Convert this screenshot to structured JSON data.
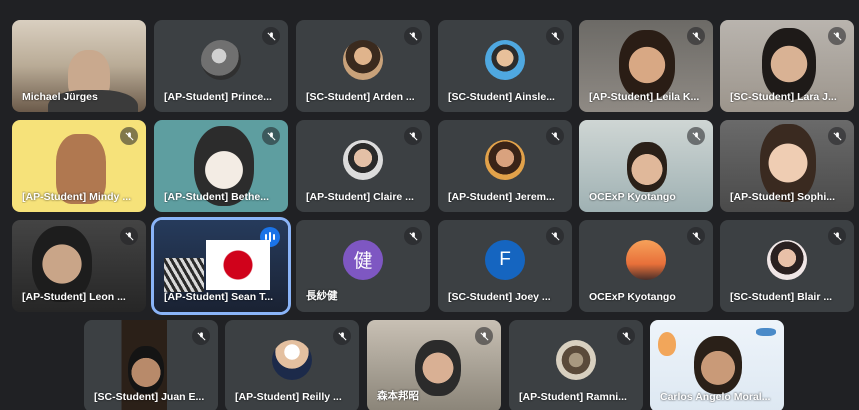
{
  "participants": [
    {
      "name": "Michael Jürges"
    },
    {
      "name": "[AP-Student] Prince..."
    },
    {
      "name": "[SC-Student] Arden ..."
    },
    {
      "name": "[SC-Student] Ainsle..."
    },
    {
      "name": "[AP-Student] Leila K..."
    },
    {
      "name": "[SC-Student] Lara J..."
    },
    {
      "name": "[AP-Student] Mindy ..."
    },
    {
      "name": "[AP-Student] Bethe..."
    },
    {
      "name": "[AP-Student] Claire ..."
    },
    {
      "name": "[AP-Student] Jerem..."
    },
    {
      "name": "OCExP Kyotango"
    },
    {
      "name": "[AP-Student] Sophi..."
    },
    {
      "name": "[AP-Student] Leon ..."
    },
    {
      "name": "[AP-Student] Sean T..."
    },
    {
      "name": "長紗健",
      "avatar_text": "健",
      "avatar_color": "#7e57c2"
    },
    {
      "name": "[SC-Student] Joey ...",
      "avatar_text": "F",
      "avatar_color": "#1565c0"
    },
    {
      "name": "OCExP Kyotango"
    },
    {
      "name": "[SC-Student] Blair ..."
    },
    {
      "name": "[SC-Student] Juan E..."
    },
    {
      "name": "[AP-Student] Reilly ..."
    },
    {
      "name": "森本邦昭"
    },
    {
      "name": "[AP-Student] Ramni..."
    },
    {
      "name": "Carlos Angelo Moral..."
    }
  ],
  "icons": {
    "muted": "mic-off-icon",
    "speaking": "audio-level-icon"
  },
  "colors": {
    "background": "#202124",
    "tile": "#3c4043",
    "active_border": "#8ab4f8",
    "speaking": "#1a73e8"
  }
}
